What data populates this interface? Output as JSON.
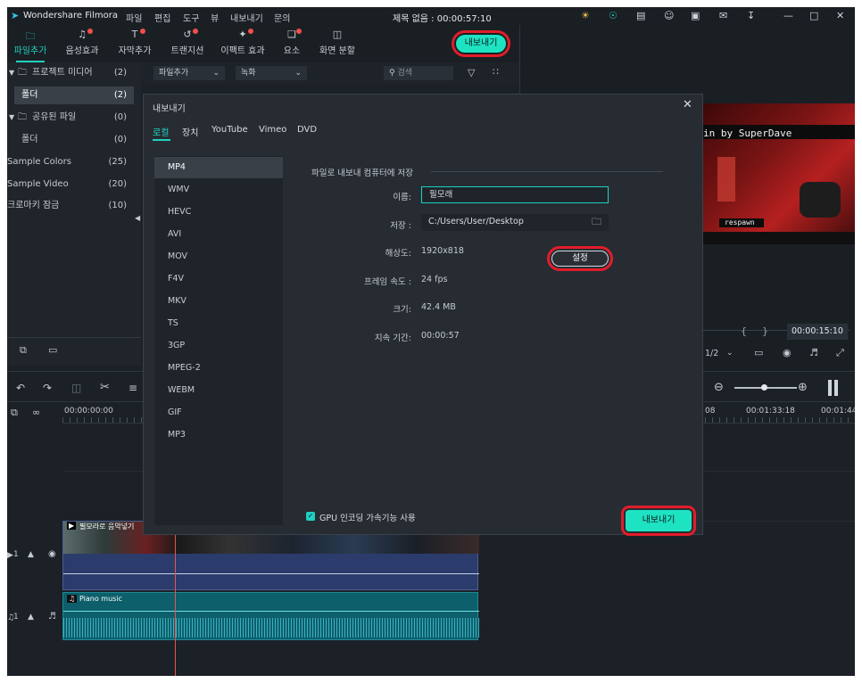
{
  "app": {
    "name": "Wondershare Filmora",
    "menu": [
      "파일",
      "편집",
      "도구",
      "뷰",
      "내보내기",
      "문의"
    ],
    "title": "제목 없음 : 00:00:57:10"
  },
  "tabs": [
    {
      "label": "파일추가",
      "icon": "folder-icon",
      "active": true,
      "dot": false
    },
    {
      "label": "음성효과",
      "icon": "music-note-icon",
      "active": false,
      "dot": true
    },
    {
      "label": "자막추가",
      "icon": "text-icon",
      "active": false,
      "dot": true
    },
    {
      "label": "트랜지션",
      "icon": "transition-icon",
      "active": false,
      "dot": true
    },
    {
      "label": "이팩트 효과",
      "icon": "effect-icon",
      "active": false,
      "dot": true
    },
    {
      "label": "요소",
      "icon": "elements-icon",
      "active": false,
      "dot": true
    },
    {
      "label": "화면 분할",
      "icon": "split-screen-icon",
      "active": false,
      "dot": false
    }
  ],
  "top_export_label": "내보내기",
  "sidebar": {
    "items": [
      {
        "label": "프로젝트 미디어",
        "count": "(2)"
      },
      {
        "label": "폴더",
        "count": "(2)"
      },
      {
        "label": "공유된 파일",
        "count": "(0)"
      },
      {
        "label": "폴더",
        "count": "(0)"
      },
      {
        "label": "Sample Colors",
        "count": "(25)"
      },
      {
        "label": "Sample Video",
        "count": "(20)"
      },
      {
        "label": "크로마키 잠금",
        "count": "(10)"
      }
    ]
  },
  "toolbar": {
    "import_label": "파일추가",
    "record_label": "녹화",
    "search_placeholder": "검색"
  },
  "preview": {
    "caption_text": "in by SuperDave",
    "respawn_text": "respawn",
    "timecode": "00:00:15:10",
    "quality": "1/2"
  },
  "timeline": {
    "ruler": [
      "00:00:00:00",
      "08",
      "00:01:33:18",
      "00:01:44"
    ],
    "video_track_label": "1",
    "audio_track_label": "1",
    "video_clip_label": "필모라로 음악넣기",
    "audio_clip_label": "Piano music"
  },
  "dialog": {
    "title": "내보내기",
    "tabs": [
      "로컬",
      "장치",
      "YouTube",
      "Vimeo",
      "DVD"
    ],
    "formats": [
      "MP4",
      "WMV",
      "HEVC",
      "AVI",
      "MOV",
      "F4V",
      "MKV",
      "TS",
      "3GP",
      "MPEG-2",
      "WEBM",
      "GIF",
      "MP3"
    ],
    "section_title": "파일로 내보내 컴퓨터에 저장",
    "name_label": "이름:",
    "name_value": "필모래",
    "save_label": "저장 :",
    "save_path": "C:/Users/User/Desktop",
    "resolution_label": "해상도:",
    "resolution_value": "1920x818",
    "settings_button": "설정",
    "framerate_label": "프레임 속도 :",
    "framerate_value": "24 fps",
    "size_label": "크기:",
    "size_value": "42.4 MB",
    "duration_label": "지속 기간:",
    "duration_value": "00:00:57",
    "gpu_label": "GPU 인코딩 가속기능 사용",
    "export_button": "내보내기"
  },
  "colors": {
    "accent": "#1de3c2",
    "highlight": "#e11d2a",
    "tab_active": "#1fd1c0"
  }
}
